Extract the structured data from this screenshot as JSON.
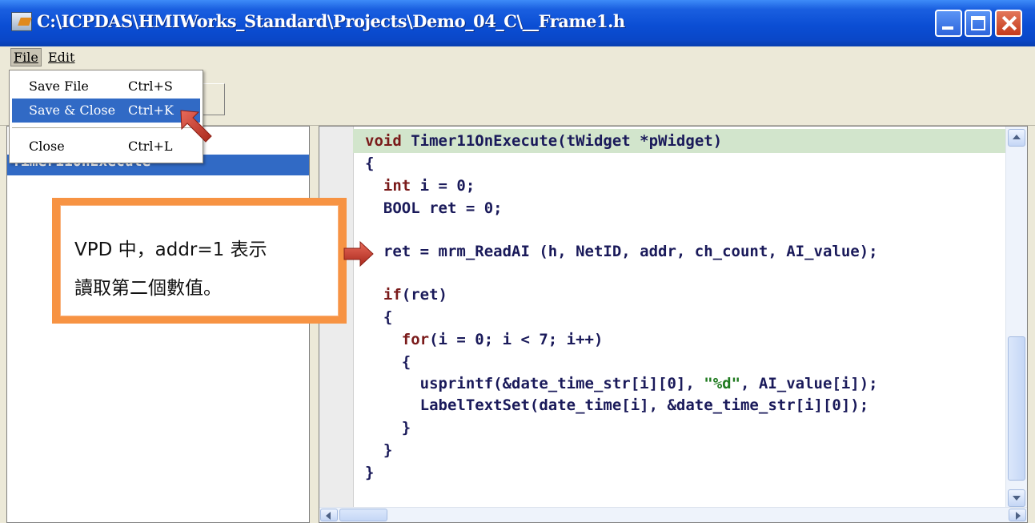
{
  "window": {
    "title": "C:\\ICPDAS\\HMIWorks_Standard\\Projects\\Demo_04_C\\__Frame1.h"
  },
  "menubar": {
    "file": "File",
    "edit": "Edit"
  },
  "file_menu": {
    "items": [
      {
        "label": "Save File",
        "shortcut": "Ctrl+S"
      },
      {
        "label": "Save & Close",
        "shortcut": "Ctrl+K"
      },
      {
        "label": "Close",
        "shortcut": "Ctrl+L"
      }
    ]
  },
  "left_panel": {
    "selected_item": "Timer11OnExecute"
  },
  "editor": {
    "lines": [
      "void Timer11OnExecute(tWidget *pWidget)",
      "{",
      "  int i = 0;",
      "  BOOL ret = 0;",
      "",
      "  ret = mrm_ReadAI (h, NetID, addr, ch_count, AI_value);",
      "",
      "  if(ret)",
      "  {",
      "    for(i = 0; i < 7; i++)",
      "    {",
      "      usprintf(&date_time_str[i][0], \"%d\", AI_value[i]);",
      "      LabelTextSet(date_time[i], &date_time_str[i][0]);",
      "    }",
      "  }",
      "}"
    ]
  },
  "annotation": {
    "line1": "VPD 中，addr=1 表示",
    "line2": "讀取第二個數值。"
  },
  "colors": {
    "title_bar": "#0a47c8",
    "selection": "#316ac5",
    "callout_border": "#f79343",
    "arrow": "#c0392b",
    "highlight_line": "#d2e5cc"
  }
}
